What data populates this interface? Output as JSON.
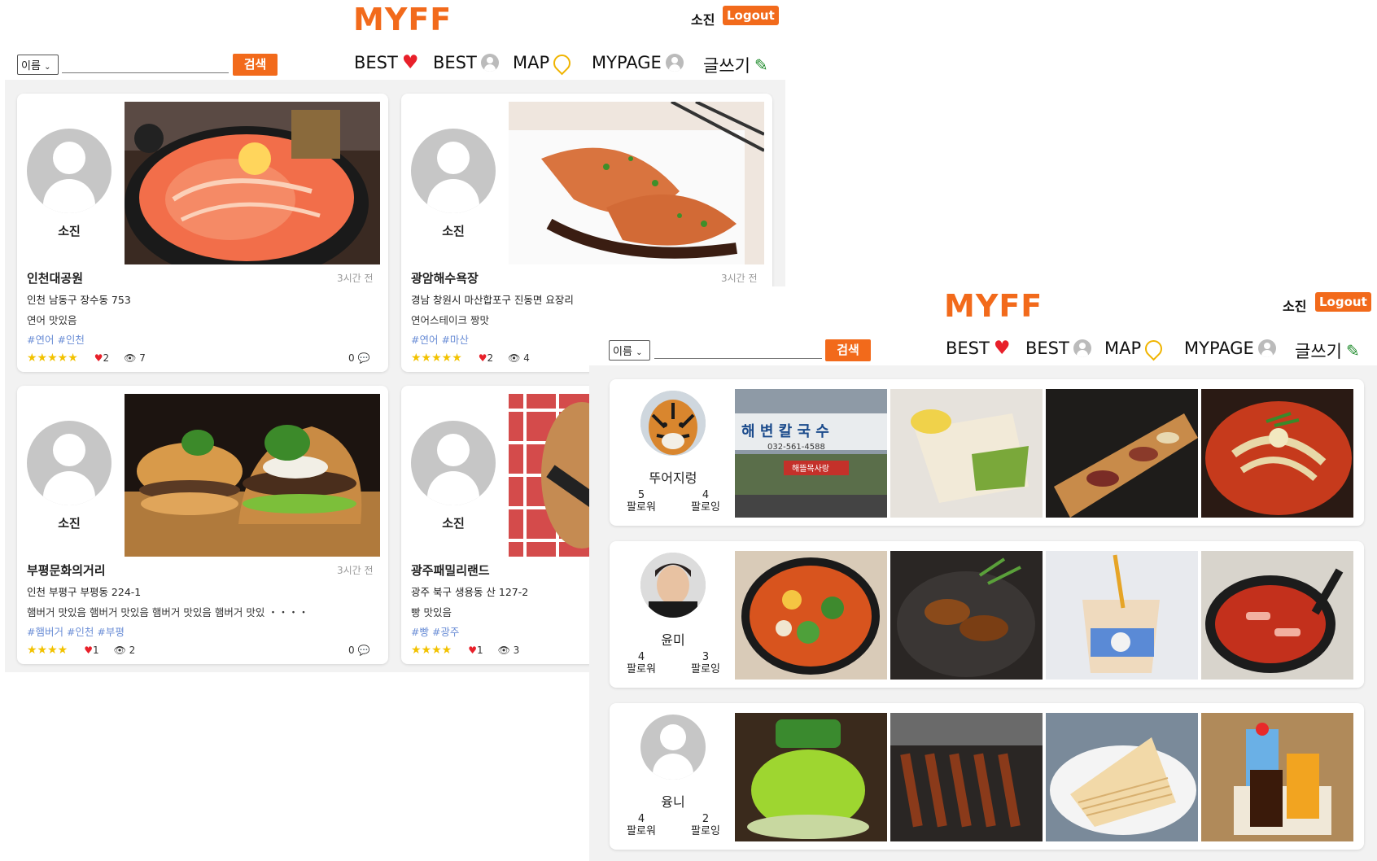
{
  "brand": {
    "logo": "MYFF",
    "accent": "#f26a1b"
  },
  "header": {
    "user_name": "소진",
    "logout_label": "Logout"
  },
  "search": {
    "select_value": "이름",
    "button_label": "검색"
  },
  "nav": [
    {
      "label": "BEST",
      "icon": "heart-icon"
    },
    {
      "label": "BEST",
      "icon": "user-icon"
    },
    {
      "label": "MAP",
      "icon": "map-pin-icon"
    },
    {
      "label": "MYPAGE",
      "icon": "user-icon"
    },
    {
      "label": "글쓰기",
      "icon": "pencil-icon"
    }
  ],
  "posts": [
    {
      "author": "소진",
      "title": "인천대공원",
      "time": "3시간 전",
      "address": "인천 남동구 장수동 753",
      "desc": "연어 맛있음",
      "tags": "#연어  #인천",
      "stars": "★★★★★",
      "likes": "2",
      "views": "7",
      "comments": "0",
      "photo": "salmon-sashimi"
    },
    {
      "author": "소진",
      "title": "광암해수욕장",
      "time": "3시간 전",
      "address": "경남 창원시 마산합포구 진동면 요장리",
      "desc": "연어스테이크 짱맛",
      "tags": "#연어  #마산",
      "stars": "★★★★★",
      "likes": "2",
      "views": "4",
      "comments": "",
      "photo": "salmon-steak"
    },
    {
      "author": "소진",
      "title": "부평문화의거리",
      "time": "3시간 전",
      "address": "인천 부평구 부평동 224-1",
      "desc": "햄버거 맛있음 햄버거 맛있음 햄버거 맛있음 햄버거 맛있 ・・・・",
      "tags": "#햄버거  #인천  #부평",
      "stars": "★★★★",
      "likes": "1",
      "views": "2",
      "comments": "0",
      "photo": "burger"
    },
    {
      "author": "소진",
      "title": "광주패밀리랜드",
      "time": "",
      "address": "광주 북구 생용동 산 127-2",
      "desc": "빵 맛있음",
      "tags": "#빵  #광주",
      "stars": "★★★★",
      "likes": "1",
      "views": "3",
      "comments": "",
      "photo": "bread"
    }
  ],
  "users": [
    {
      "name": "뚜어지렁",
      "followers": "5",
      "following": "4",
      "avatar": "tiger-photo"
    },
    {
      "name": "윤미",
      "followers": "4",
      "following": "3",
      "avatar": "person-photo"
    },
    {
      "name": "융니",
      "followers": "4",
      "following": "2",
      "avatar": "default-avatar"
    }
  ],
  "labels": {
    "followers": "팔로워",
    "following": "팔로잉"
  },
  "thumb_sign_text": "해 변 칼 국 수",
  "thumb_phone": "032-561-4588",
  "thumb_shop_sign": "해뜰목사랑"
}
